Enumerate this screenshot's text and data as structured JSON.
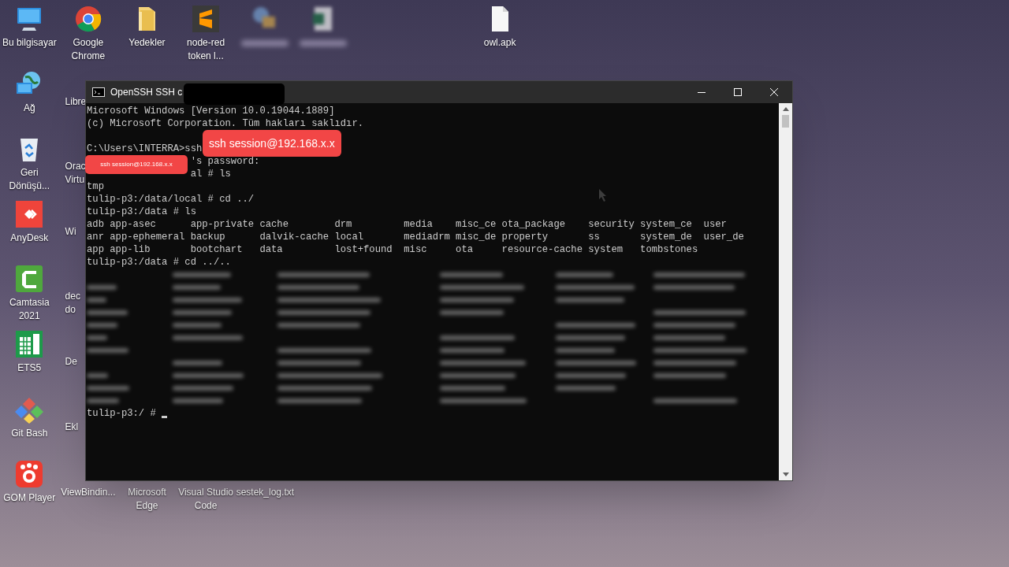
{
  "desktop_icons": [
    {
      "kind": "computer",
      "label": "Bu bilgisayar"
    },
    {
      "kind": "chrome",
      "label": "Google Chrome"
    },
    {
      "kind": "folder",
      "label": "Yedekler"
    },
    {
      "kind": "sublime",
      "label": "node-red token l..."
    },
    {
      "kind": "blurred"
    },
    {
      "kind": "blurred-sheet"
    },
    {
      "kind": "file",
      "label": "owl.apk"
    },
    {
      "kind": "network",
      "label": "Ağ"
    },
    {
      "kind": "peek",
      "label": "Libre"
    },
    {
      "kind": "recycle",
      "label": "Geri Dönüşü..."
    },
    {
      "kind": "peek",
      "label": "Orac Virtu"
    },
    {
      "kind": "anydesk",
      "label": "AnyDesk"
    },
    {
      "kind": "peek",
      "label": "Wi"
    },
    {
      "kind": "camtasia",
      "label": "Camtasia 2021"
    },
    {
      "kind": "peek",
      "label": "dec do"
    },
    {
      "kind": "ets",
      "label": "ETS5"
    },
    {
      "kind": "peek",
      "label": "De"
    },
    {
      "kind": "gitbash",
      "label": "Git Bash"
    },
    {
      "kind": "peek",
      "label": "Ekl"
    },
    {
      "kind": "gom",
      "label": "GOM Player"
    },
    {
      "kind": "label-only",
      "label": "ViewBindin..."
    },
    {
      "kind": "label-only",
      "label": "Microsoft Edge"
    },
    {
      "kind": "label-only",
      "label": "Visual Studio Code"
    },
    {
      "kind": "label-only",
      "label": "sestek_log.txt"
    }
  ],
  "terminal": {
    "title": "OpenSSH SSH c",
    "lines": [
      {
        "kind": "text",
        "text": "Microsoft Windows [Version 10.0.19044.1889]"
      },
      {
        "kind": "text",
        "text": "(c) Microsoft Corporation. Tüm hakları saklıdır."
      },
      {
        "kind": "blank"
      },
      {
        "kind": "text",
        "text": "C:\\Users\\INTERRA>ssh"
      },
      {
        "kind": "partial",
        "text": "'s password:"
      },
      {
        "kind": "partial",
        "text": "al # ls"
      },
      {
        "kind": "text",
        "text": "tmp"
      },
      {
        "kind": "text",
        "text": "tulip-p3:/data/local # cd ../"
      },
      {
        "kind": "text",
        "text": "tulip-p3:/data # ls"
      },
      {
        "kind": "text",
        "text": "adb app-asec      app-private cache        drm         media    misc_ce ota_package    security system_ce  user"
      },
      {
        "kind": "text",
        "text": "anr app-ephemeral backup      dalvik-cache local       mediadrm misc_de property       ss       system_de  user_de"
      },
      {
        "kind": "text",
        "text": "app app-lib       bootchart   data         lost+found  misc     ota     resource-cache system   tombstones"
      },
      {
        "kind": "text",
        "text": "tulip-p3:/data # cd ../.."
      },
      {
        "kind": "blurred"
      },
      {
        "kind": "blurred"
      },
      {
        "kind": "blurred"
      },
      {
        "kind": "blurred"
      },
      {
        "kind": "blurred"
      },
      {
        "kind": "blurred"
      },
      {
        "kind": "blurred"
      },
      {
        "kind": "blurred"
      },
      {
        "kind": "blurred"
      },
      {
        "kind": "blurred"
      },
      {
        "kind": "blurred"
      },
      {
        "kind": "prompt",
        "text": "tulip-p3:/ # "
      }
    ]
  },
  "annotation_large": {
    "text": "ssh session@192.168.x.x"
  },
  "annotation_small": {
    "text": "ssh session@192.168.x.x"
  }
}
